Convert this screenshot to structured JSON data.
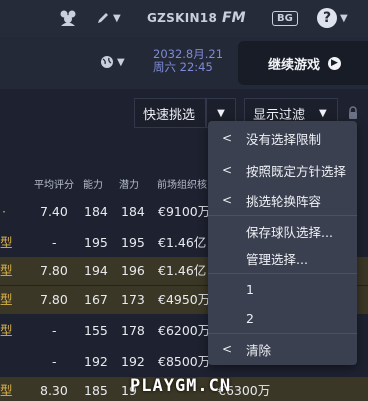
{
  "topbar": {
    "club_name": "GZSKIN18",
    "fm_logo": "FM",
    "bg_label": "BG",
    "help_glyph": "?"
  },
  "game": {
    "date": "2032.8月.21",
    "time": "周六 22:45",
    "continue_label": "继续游戏"
  },
  "toolbar": {
    "quick_pick_label": "快速挑选",
    "display_filter_label": "显示过滤"
  },
  "table": {
    "headers": [
      "平均评分",
      "能力",
      "潜力",
      "前场组织核..."
    ],
    "rows": [
      {
        "type": "",
        "rating": "7.40",
        "ca": "184",
        "pa": "184",
        "value": "€9100万",
        "highlight": false
      },
      {
        "type": "型",
        "rating": "-",
        "ca": "195",
        "pa": "195",
        "value": "€1.46亿",
        "highlight": false
      },
      {
        "type": "型",
        "rating": "7.80",
        "ca": "194",
        "pa": "196",
        "value": "€1.46亿",
        "highlight": true
      },
      {
        "type": "型",
        "rating": "7.80",
        "ca": "167",
        "pa": "173",
        "value": "€4950万",
        "highlight": true
      },
      {
        "type": "型",
        "rating": "-",
        "ca": "155",
        "pa": "178",
        "value": "€6200万",
        "highlight": false
      },
      {
        "type": "",
        "rating": "-",
        "ca": "192",
        "pa": "192",
        "value": "€8500万",
        "highlight": false
      },
      {
        "type": "型",
        "rating": "8.30",
        "ca": "185",
        "pa": "19",
        "value": "€6300万",
        "highlight": true
      }
    ]
  },
  "menu": {
    "items": [
      {
        "label": "没有选择限制",
        "caret": "<"
      },
      {
        "label": "按照既定方针选择",
        "caret": "<"
      },
      {
        "label": "挑选轮换阵容",
        "caret": "<"
      },
      {
        "label": "保存球队选择...",
        "caret": ""
      },
      {
        "label": "管理选择...",
        "caret": ""
      },
      {
        "label": "1",
        "caret": ""
      },
      {
        "label": "2",
        "caret": ""
      },
      {
        "label": "清除",
        "caret": "<"
      }
    ]
  },
  "watermark": "PLAYGM.CN",
  "colors": {
    "accent_date": "#7f8bd6",
    "highlight_row": "#3b3726",
    "type_text": "#d9b24c"
  },
  "icons": [
    "team-icon",
    "pen-icon",
    "globe-icon",
    "lock-icon",
    "arrow-right-icon",
    "chevron-down-icon",
    "chevron-left-icon"
  ]
}
